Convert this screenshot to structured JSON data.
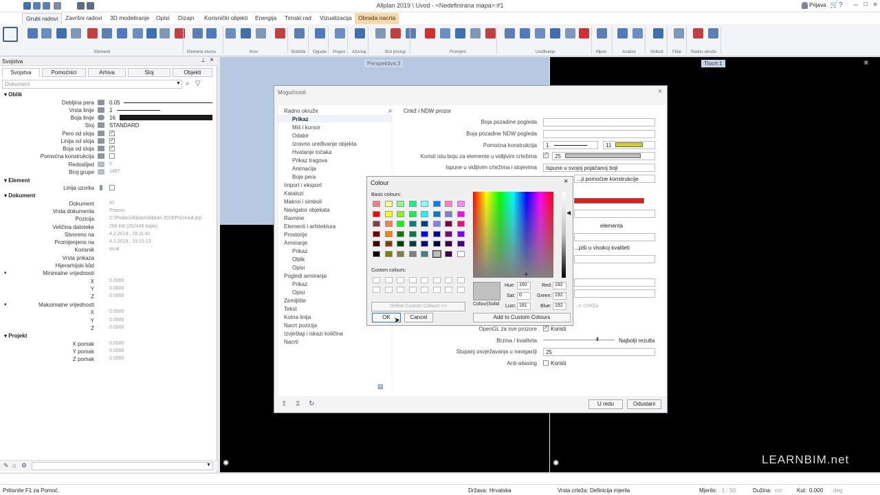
{
  "window": {
    "title": "Allplan 2019 \\ Uvod - <Nedefinirana mapa>:#1",
    "user": "Prijava"
  },
  "menu": {
    "tabs": [
      "Grubi radovi",
      "Završni radovi",
      "3D modeliranje",
      "Opisi",
      "Dizajn",
      "Korisnički objekti",
      "Energija",
      "Timski rad",
      "Vizualizacija",
      "Obrada nacrta"
    ]
  },
  "ribbon": {
    "groups": [
      "Elementi",
      "Elementi otvora",
      "Krov",
      "Stubište",
      "Ograde",
      "Prejeci",
      "Ažuriraj",
      "Brzi pristup",
      "Promjeni",
      "Uređivanje",
      "Mjere",
      "Analize",
      "Atributi",
      "Filtar",
      "Radno okruže"
    ]
  },
  "properties": {
    "title": "Svojstva",
    "tabs": [
      "Svojstva",
      "Pomoćnici",
      "Arhiva",
      "Sloj",
      "Objekti"
    ],
    "doc_placeholder": "Dokument",
    "section_oblik": "Oblik",
    "debljina_label": "Debljina pera",
    "debljina_val": "0.05",
    "vrsta_label": "Vrsta linije",
    "vrsta_val": "1",
    "boja_label": "Boja linije",
    "boja_val": "16",
    "sloj_label": "Sloj",
    "sloj_val": "STANDARD",
    "pero_label": "Pero od sloja",
    "linija_label": "Linija od sloja",
    "bojaod_label": "Boja od sloja",
    "pomocna_label": "Pomoćna konstrukcija",
    "redoslijed_label": "Redoslijed",
    "redoslijed_val": "0",
    "broj_label": "Broj grupe",
    "broj_val": "1487",
    "section_element": "Element",
    "uzorka_label": "Linija uzorka",
    "section_dokument": "Dokument",
    "dok_label": "Dokument",
    "dok_val": "#1",
    "vdok_label": "Vrsta dokumenta",
    "vdok_val": "Prazno",
    "poz_label": "Pozicija",
    "poz_val": "C:\\Podaci\\Allplan\\Allplan 2019\\Prj\\Uvod.prj\\",
    "vel_label": "Veličina datoteke",
    "vel_val": "256 KB (262446 bajta)",
    "stv_label": "Stvoreno na",
    "stv_val": "4.2.2019., 18:11:41",
    "prom_label": "Promijenjeno na",
    "prom_val": "4.2.2019., 19:10:13",
    "kor_label": "Korisnik",
    "kor_val": "local",
    "vpr_label": "Vrsta prikaza",
    "hij_label": "Hijerarhijski kôd",
    "min_label": "Minimalne vrijednosti",
    "max_label": "Maksimalne vrijednosti",
    "x": "X",
    "y": "Y",
    "z": "Z",
    "zero": "0.0000",
    "section_projekt": "Projekt",
    "xp_label": "X pomak",
    "yp_label": "Y pomak",
    "zp_label": "Z pomak"
  },
  "viewports": {
    "left": "Perspektiva:3",
    "right": "Tlocrt:1",
    "watermark": "LEARNBIM.net"
  },
  "options": {
    "title": "Mogućnosti",
    "nav": [
      "Radno okruže",
      "Prikaz",
      "Miš i kursor",
      "Odabir",
      "Izravno uređivanje objekta",
      "Hvatanje točaka",
      "Prikaz tragova",
      "Animacija",
      "Boje pera",
      "Import i eksport",
      "Katalozi",
      "Makroi i simboli",
      "Navigator objekata",
      "Ravnine",
      "Elementi i arhitektura",
      "Prostorije",
      "Armiranje",
      "Prikaz",
      "Oblik",
      "Opisi",
      "Pogledi armiranja",
      "Prikaz",
      "Opisi",
      "Zemljište",
      "Tekst",
      "Kotna linija",
      "Nacrt pozicija",
      "Izvještaji i iskazi količina",
      "Nacrti"
    ],
    "section": "Crtež i NDW prozor",
    "boja_poz": "Boja pozadine pogleda",
    "boja_ndw": "Boja pozadine NDW pogleda",
    "pomocna": "Pomoćna konstrukcija",
    "pomocna_a": "1",
    "pomocna_b": "11",
    "koristi": "Koristi istu boju za elemente u vidljivim crtežima",
    "koristi_val": "25",
    "ispune": "Ispune u vidljivim crtežima i slojevima",
    "ispune_val": "Ispune u svojoj pojačanoj boji",
    "pomocne_val": "...ji pomoćne konstrukcije",
    "elementa": "elementa",
    "kvaliteta": "...piši u visokoj kvaliteti",
    "opengl": "OpenGL za sve prozore",
    "opengl_val": "Koristi",
    "brzina": "Brzina / kvaliteta",
    "brzina_right": "Najbolji rezulta",
    "stupanj": "Stupanj osvježavanja u navigaciji",
    "stupanj_val": "25",
    "anti": "Anti-aliasing",
    "anti_val": "Koristi",
    "crteza": "...n crteža",
    "ok": "U redu",
    "cancel": "Odustani"
  },
  "colour": {
    "title": "Colour",
    "basic": "Basic colours:",
    "custom": "Custom colours:",
    "define": "Define Custom Colours >>",
    "ok": "OK",
    "cancel": "Cancel",
    "colorsolid": "Colour|Solid",
    "add": "Add to Custom Colours",
    "hue_l": "Hue:",
    "hue": "160",
    "sat_l": "Sat:",
    "sat": "0",
    "lum_l": "Lum:",
    "lum": "181",
    "red_l": "Red:",
    "red": "192",
    "green_l": "Green:",
    "green": "192",
    "blue_l": "Blue:",
    "blue": "192",
    "swatches": [
      "#f08080",
      "#ffff80",
      "#80ff80",
      "#00ff80",
      "#80ffff",
      "#0080ff",
      "#ff80c0",
      "#ff80ff",
      "#ff0000",
      "#ffff00",
      "#80ff00",
      "#00ff40",
      "#00ffff",
      "#0080c0",
      "#8080c0",
      "#ff00ff",
      "#804040",
      "#ff8040",
      "#00ff00",
      "#008080",
      "#004080",
      "#8080ff",
      "#800040",
      "#ff0080",
      "#800000",
      "#ff8000",
      "#008000",
      "#008040",
      "#0000ff",
      "#0000a0",
      "#800080",
      "#8000ff",
      "#400000",
      "#804000",
      "#004000",
      "#004040",
      "#000080",
      "#000040",
      "#400040",
      "#400080",
      "#000000",
      "#808000",
      "#808040",
      "#808080",
      "#408080",
      "#c0c0c0",
      "#400040",
      "#ffffff"
    ],
    "preview": "#c0c0c0"
  },
  "status": {
    "hint": "Pritisnite F1 za Pomoć.",
    "drzava_l": "Država:",
    "drzava": "Hrvatska",
    "vrsta_l": "Vrsta crteža:",
    "vrsta": "Definicija mjerila",
    "mjerilo_l": "Mjerilo:",
    "mjerilo": "1 : 50",
    "duzina_l": "Dužina:",
    "duzina": "cm",
    "kut_l": "Kut:",
    "kut": "0.000",
    "deg": "deg"
  }
}
